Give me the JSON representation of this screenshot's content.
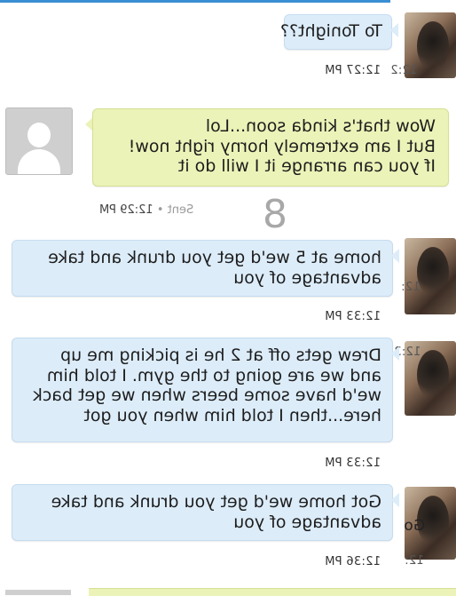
{
  "messages": [
    {
      "id": "m1",
      "lines": [
        "To Tonight??"
      ],
      "time": "12:27 PM"
    },
    {
      "id": "m2",
      "lines": [
        "Wow that's kinda soon...Lol",
        "But I am extremely horny right now!",
        "If you can arrange it I will do it"
      ],
      "status": "Sent",
      "separator": "•",
      "time": "12:29 PM"
    },
    {
      "id": "m3",
      "lines": [
        "home at 5 we'd get you drunk and take",
        "advantage of you"
      ],
      "time": "12:33 PM"
    },
    {
      "id": "m4",
      "lines": [
        "Drew gets off at 2 he is picking me up",
        "and we are going to the gym. I told him",
        "we'd have some beers when we get back",
        "here...then I told him when you got"
      ],
      "time": "12:33 PM"
    },
    {
      "id": "m5",
      "lines": [
        "Got home we'd get you drunk and take",
        "advantage of you"
      ],
      "time": "12:36 PM"
    }
  ],
  "overlay": {
    "page_number": "8"
  },
  "fragments": {
    "a": "12:2",
    "b": "12:",
    "c": "12:3",
    "d": "12:3",
    "e": "Go",
    "f": "12:"
  }
}
